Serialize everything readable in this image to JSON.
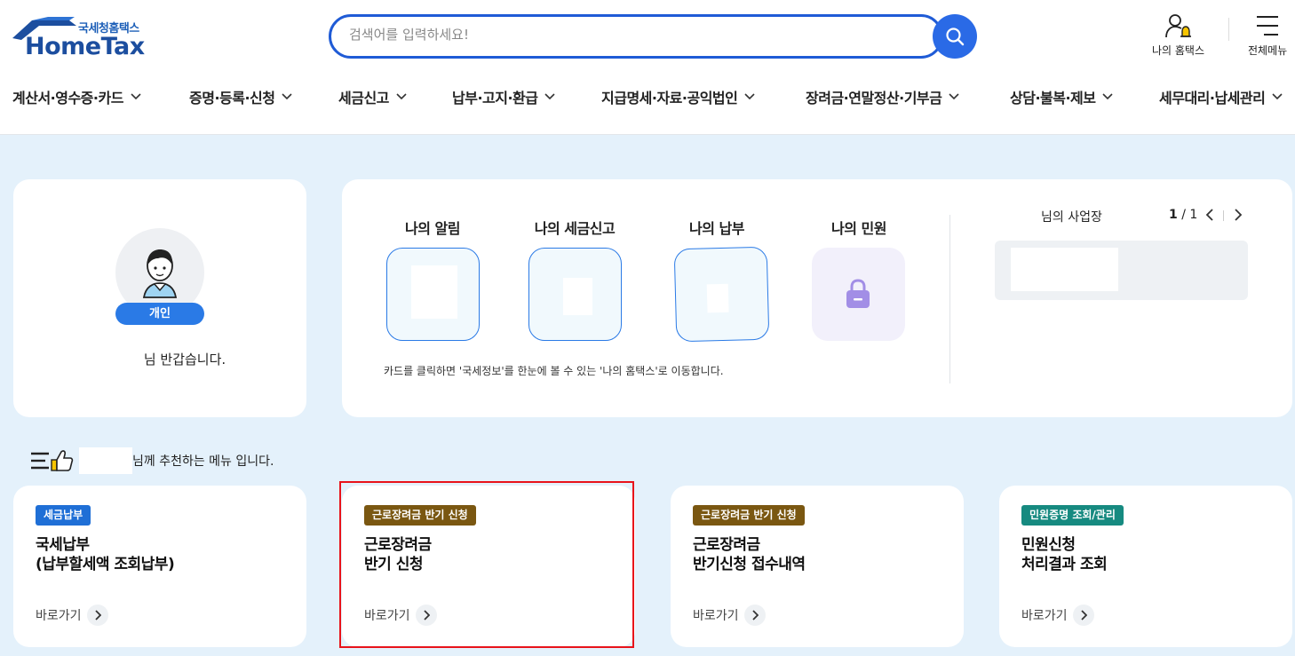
{
  "header": {
    "logo_sub": "국세청홈택스",
    "logo_main": "HomeTax",
    "search_placeholder": "검색어를 입력하세요!",
    "my_hometax_label": "나의 홈택스",
    "all_menu_label": "전체메뉴"
  },
  "gnb": [
    {
      "label": "계산서·영수증·카드"
    },
    {
      "label": "증명·등록·신청"
    },
    {
      "label": "세금신고"
    },
    {
      "label": "납부·고지·환급"
    },
    {
      "label": "지급명세·자료·공익법인"
    },
    {
      "label": "장려금·연말정산·기부금"
    },
    {
      "label": "상담·불복·제보"
    },
    {
      "label": "세무대리·납세관리"
    }
  ],
  "profile": {
    "type_badge": "개인",
    "greeting": "님 반갑습니다."
  },
  "my": {
    "items": [
      {
        "label": "나의 알림"
      },
      {
        "label": "나의 세금신고"
      },
      {
        "label": "나의 납부"
      },
      {
        "label": "나의 민원"
      }
    ],
    "note": "카드를 클릭하면 '국세정보'를 한눈에 볼 수 있는 '나의 홈택스'로 이동합니다.",
    "biz_title": "님의 사업장",
    "pager_current": "1",
    "pager_total": " / 1"
  },
  "recommend": {
    "heading": "님께 추천하는 메뉴 입니다.",
    "cards": [
      {
        "badge": "세금납부",
        "badge_color": "#1f6fd6",
        "title_line1": "국세납부",
        "title_line2": "(납부할세액 조회납부)",
        "link": "바로가기"
      },
      {
        "badge": "근로장려금 반기 신청",
        "badge_color": "#7a5711",
        "title_line1": "근로장려금",
        "title_line2": "반기 신청",
        "link": "바로가기"
      },
      {
        "badge": "근로장려금 반기 신청",
        "badge_color": "#7a5711",
        "title_line1": "근로장려금",
        "title_line2": "반기신청 접수내역",
        "link": "바로가기"
      },
      {
        "badge": "민원증명 조회/관리",
        "badge_color": "#168a80",
        "title_line1": "민원신청",
        "title_line2": "처리결과 조회",
        "link": "바로가기"
      }
    ]
  },
  "colors": {
    "primary": "#2a6ae6",
    "main_bg": "#e4f1fb",
    "highlight": "#e8131b"
  }
}
